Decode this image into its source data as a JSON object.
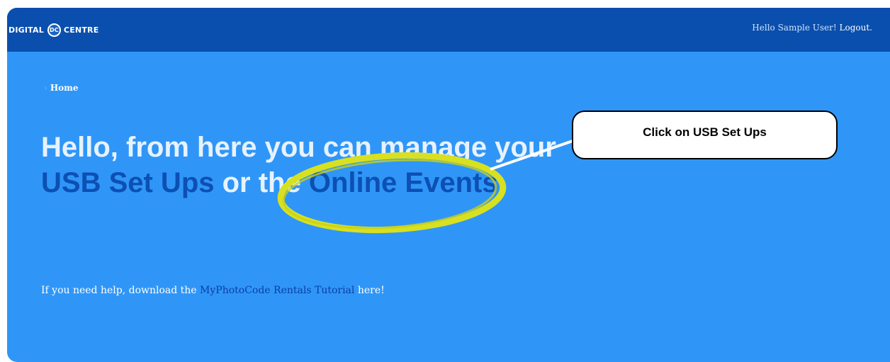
{
  "header": {
    "logo_left": "DIGITAL",
    "logo_mark": "DC",
    "logo_right": "CENTRE",
    "greeting": "Hello Sample User!",
    "logout_label": "Logout."
  },
  "breadcrumb": {
    "separator": "›",
    "home_label": "Home"
  },
  "headline": {
    "part1": "Hello, from here you can manage your ",
    "link1": "USB Set Ups",
    "part2": " or the ",
    "link2": "Online Events",
    "part3": "."
  },
  "help": {
    "prefix": "If you need help, download the ",
    "link": "MyPhotoCode Rentals Tutorial",
    "suffix": " here!"
  },
  "annotation": {
    "callout_text": "Click on USB Set Ups",
    "highlight_color": "#d8e020"
  },
  "colors": {
    "topbar": "#0a4fae",
    "page_bg": "#2f96f7",
    "link": "#0d4fb3"
  }
}
